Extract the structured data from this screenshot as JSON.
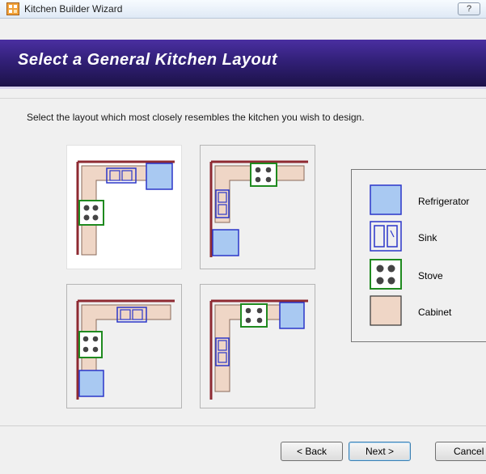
{
  "window": {
    "title": "Kitchen Builder Wizard",
    "help_label": "?"
  },
  "header": {
    "title": "Select a General Kitchen Layout"
  },
  "instruction": "Select the layout which most closely resembles the kitchen you wish to design.",
  "layouts": [
    {
      "name": "layout-option-1",
      "selected": true
    },
    {
      "name": "layout-option-2",
      "selected": false
    },
    {
      "name": "layout-option-3",
      "selected": false
    },
    {
      "name": "layout-option-4",
      "selected": false
    }
  ],
  "legend": {
    "items": [
      {
        "icon": "refrigerator-icon",
        "label": "Refrigerator"
      },
      {
        "icon": "sink-icon",
        "label": "Sink"
      },
      {
        "icon": "stove-icon",
        "label": "Stove"
      },
      {
        "icon": "cabinet-icon",
        "label": "Cabinet"
      }
    ]
  },
  "buttons": {
    "back": "< Back",
    "next": "Next >",
    "cancel": "Cancel"
  },
  "colors": {
    "cabinet": "#efd6c6",
    "wall": "#8e2a32",
    "refrigerator": "#a9c9f2",
    "sink_stroke": "#2b36c9",
    "stove_stroke": "#1f8a1f",
    "banner": "#322078"
  }
}
